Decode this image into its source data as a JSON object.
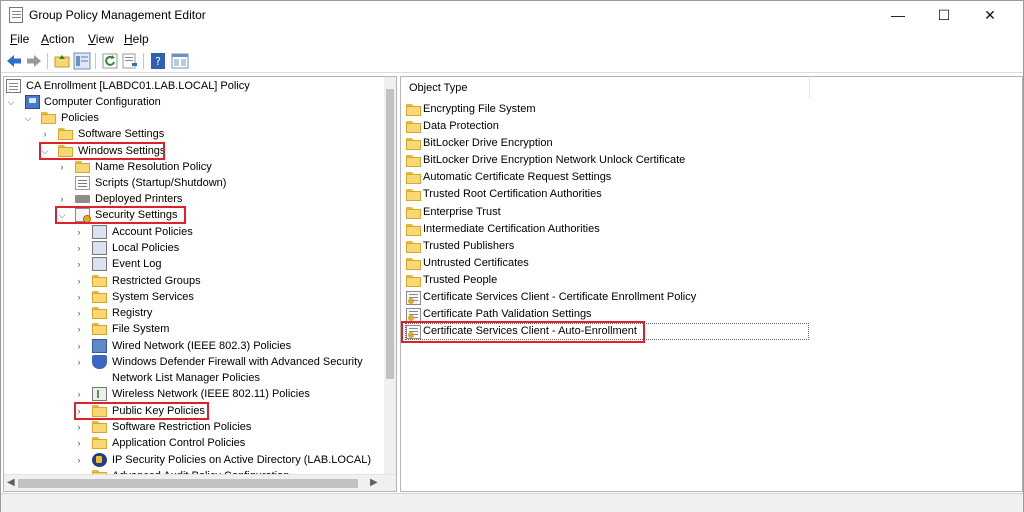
{
  "window": {
    "title": "Group Policy Management Editor",
    "minimize": "—",
    "maximize": "☐",
    "close": "✕"
  },
  "menu": [
    {
      "pre": "",
      "key": "F",
      "post": "ile"
    },
    {
      "pre": "",
      "key": "A",
      "post": "ction"
    },
    {
      "pre": "",
      "key": "V",
      "post": "iew"
    },
    {
      "pre": "",
      "key": "H",
      "post": "elp"
    }
  ],
  "tree": {
    "root": "CA Enrollment [LABDC01.LAB.LOCAL] Policy",
    "computer_configuration": "Computer Configuration",
    "policies": "Policies",
    "software_settings": "Software Settings",
    "windows_settings": "Windows Settings",
    "name_resolution_policy": "Name Resolution Policy",
    "scripts": "Scripts (Startup/Shutdown)",
    "deployed_printers": "Deployed Printers",
    "security_settings": "Security Settings",
    "account_policies": "Account Policies",
    "local_policies": "Local Policies",
    "event_log": "Event Log",
    "restricted_groups": "Restricted Groups",
    "system_services": "System Services",
    "registry": "Registry",
    "file_system": "File System",
    "wired_network": "Wired Network (IEEE 802.3) Policies",
    "defender_firewall": "Windows Defender Firewall with Advanced Security",
    "network_list_manager": "Network List Manager Policies",
    "wireless_network": "Wireless Network (IEEE 802.11) Policies",
    "public_key_policies": "Public Key Policies",
    "software_restriction": "Software Restriction Policies",
    "application_control": "Application Control Policies",
    "ip_security": "IP Security Policies on Active Directory (LAB.LOCAL)",
    "advanced_audit": "Advanced Audit Policy Configuration"
  },
  "list": {
    "column_header": "Object Type",
    "items": [
      "Encrypting File System",
      "Data Protection",
      "BitLocker Drive Encryption",
      "BitLocker Drive Encryption Network Unlock Certificate",
      "Automatic Certificate Request Settings",
      "Trusted Root Certification Authorities",
      "Enterprise Trust",
      "Intermediate Certification Authorities",
      "Trusted Publishers",
      "Untrusted Certificates",
      "Trusted People",
      "Certificate Services Client - Certificate Enrollment Policy",
      "Certificate Path Validation Settings",
      "Certificate Services Client - Auto-Enrollment"
    ]
  },
  "colors": {
    "highlight": "#e0202a"
  }
}
